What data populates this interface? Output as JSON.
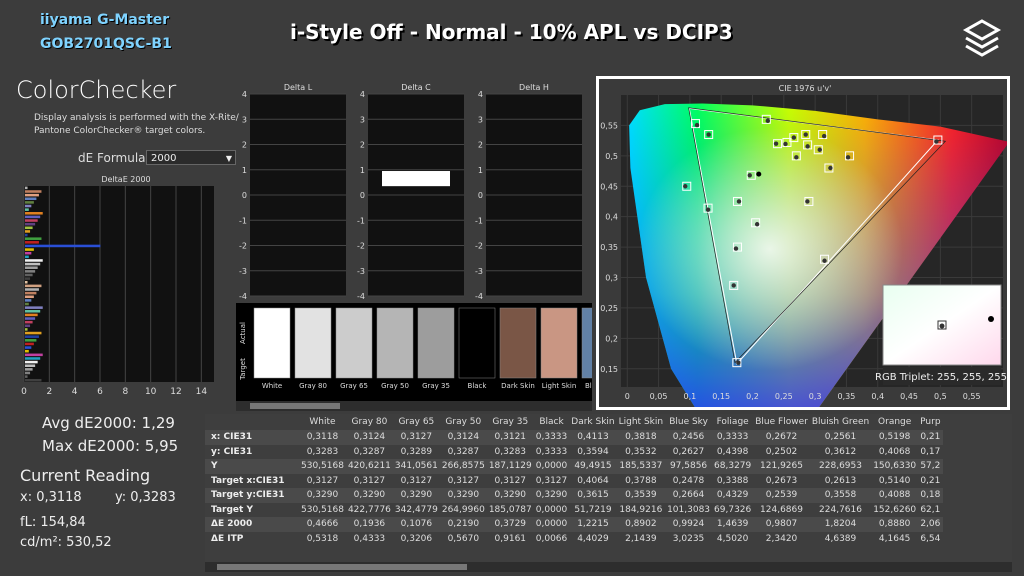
{
  "monitor": {
    "line1": "iiyama G-Master",
    "line2": "GOB2701QSC-B1"
  },
  "title": "i-Style Off - Normal - 10% APL vs DCIP3",
  "logo_icon": "stacked-hexagon-logo",
  "colorchecker": {
    "title": "ColorChecker",
    "description_line1": "Display analysis is performed with the X-Rite/",
    "description_line2": "Pantone ColorChecker® target colors.",
    "formula_label": "dE Formula:",
    "formula_value": "2000"
  },
  "de_bar_chart": {
    "title": "DeltaE 2000",
    "x_ticks": [
      "0",
      "2",
      "4",
      "6",
      "8",
      "10",
      "12",
      "14"
    ],
    "xlim": [
      0,
      15
    ],
    "highlight_bar": {
      "row": 16,
      "value": 5.95,
      "color": "#2a4fd6"
    }
  },
  "delta_charts": [
    {
      "title": "Delta L",
      "y_ticks": [
        "4",
        "3",
        "2",
        "1",
        "0",
        "-1",
        "-2",
        "-3",
        "-4"
      ],
      "value": null
    },
    {
      "title": "Delta C",
      "y_ticks": [
        "4",
        "3",
        "2",
        "1",
        "0",
        "-1",
        "-2",
        "-3",
        "-4"
      ],
      "value": 0.35
    },
    {
      "title": "Delta H",
      "y_ticks": [
        "4",
        "3",
        "2",
        "1",
        "0",
        "-1",
        "-2",
        "-3",
        "-4"
      ],
      "value": null
    }
  ],
  "swatches": {
    "actual_label": "Actual",
    "target_label": "Target",
    "items": [
      {
        "name": "White",
        "color": "#ffffff"
      },
      {
        "name": "Gray 80",
        "color": "#e2e2e2"
      },
      {
        "name": "Gray 65",
        "color": "#cccccc"
      },
      {
        "name": "Gray 50",
        "color": "#b5b5b5"
      },
      {
        "name": "Gray 35",
        "color": "#9d9d9d"
      },
      {
        "name": "Black",
        "color": "#000000"
      },
      {
        "name": "Dark Skin",
        "color": "#7a5646"
      },
      {
        "name": "Light Skin",
        "color": "#c99683"
      },
      {
        "name": "Blue Sky",
        "color": "#6281a6"
      }
    ]
  },
  "stats": {
    "avg": "Avg dE2000: 1,29",
    "max": "Max dE2000: 5,95",
    "current_reading": "Current Reading",
    "x": "x: 0,3118",
    "y": "y: 0,3283",
    "fl": "fL: 154,84",
    "cdm2": "cd/m²: 530,52"
  },
  "cie": {
    "title": "CIE 1976 u'v'",
    "x_ticks": [
      "0",
      "0,05",
      "0,1",
      "0,15",
      "0,2",
      "0,25",
      "0,3",
      "0,35",
      "0,4",
      "0,45",
      "0,5",
      "0,55"
    ],
    "y_ticks": [
      "0,55",
      "0,5",
      "0,45",
      "0,4",
      "0,35",
      "0,3",
      "0,25",
      "0,2",
      "0,15"
    ],
    "rgb_triplet": "RGB Triplet: 255, 255, 255"
  },
  "table": {
    "columns": [
      "White",
      "Gray 80",
      "Gray 65",
      "Gray 50",
      "Gray 35",
      "Black",
      "Dark Skin",
      "Light Skin",
      "Blue Sky",
      "Foliage",
      "Blue Flower",
      "Bluish Green",
      "Orange",
      "Purp"
    ],
    "rows": [
      {
        "label": "x: CIE31",
        "values": [
          "0,3118",
          "0,3124",
          "0,3127",
          "0,3124",
          "0,3121",
          "0,3333",
          "0,4113",
          "0,3818",
          "0,2456",
          "0,3333",
          "0,2672",
          "0,2561",
          "0,5198",
          "0,21"
        ]
      },
      {
        "label": "y: CIE31",
        "values": [
          "0,3283",
          "0,3287",
          "0,3289",
          "0,3287",
          "0,3283",
          "0,3333",
          "0,3594",
          "0,3532",
          "0,2627",
          "0,4398",
          "0,2502",
          "0,3612",
          "0,4068",
          "0,17"
        ]
      },
      {
        "label": "Y",
        "values": [
          "530,5168",
          "420,6211",
          "341,0561",
          "266,8575",
          "187,1129",
          "0,0000",
          "49,4915",
          "185,5337",
          "97,5856",
          "68,3279",
          "121,9265",
          "228,6953",
          "150,6330",
          "57,2"
        ]
      },
      {
        "label": "Target x:CIE31",
        "values": [
          "0,3127",
          "0,3127",
          "0,3127",
          "0,3127",
          "0,3127",
          "0,3127",
          "0,4064",
          "0,3788",
          "0,2478",
          "0,3388",
          "0,2673",
          "0,2613",
          "0,5140",
          "0,21"
        ]
      },
      {
        "label": "Target y:CIE31",
        "values": [
          "0,3290",
          "0,3290",
          "0,3290",
          "0,3290",
          "0,3290",
          "0,3290",
          "0,3615",
          "0,3539",
          "0,2664",
          "0,4329",
          "0,2539",
          "0,3558",
          "0,4088",
          "0,18"
        ]
      },
      {
        "label": "Target Y",
        "values": [
          "530,5168",
          "422,7776",
          "342,4779",
          "264,9960",
          "185,0787",
          "0,0000",
          "51,7219",
          "184,9216",
          "101,3083",
          "69,7326",
          "124,6869",
          "224,7616",
          "152,6260",
          "62,1"
        ]
      },
      {
        "label": "ΔE 2000",
        "values": [
          "0,4666",
          "0,1936",
          "0,1076",
          "0,2190",
          "0,3729",
          "0,0000",
          "1,2215",
          "0,8902",
          "0,9924",
          "1,4639",
          "0,9807",
          "1,8204",
          "0,8880",
          "2,06"
        ]
      },
      {
        "label": "ΔE ITP",
        "values": [
          "0,5318",
          "0,4333",
          "0,3206",
          "0,5670",
          "0,9161",
          "0,0066",
          "4,4029",
          "2,1439",
          "3,0235",
          "4,5020",
          "2,3420",
          "4,6389",
          "4,1645",
          "6,54"
        ]
      }
    ]
  }
}
